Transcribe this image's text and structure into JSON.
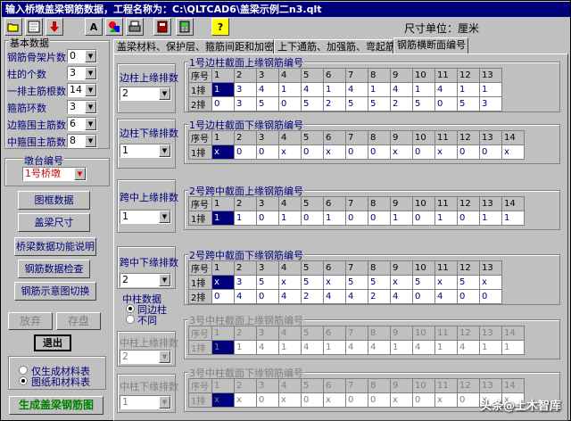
{
  "window": {
    "title": "输入桥墩盖梁钢筋数据，工程名称为：C:\\QLTCAD6\\盖梁示例二n3.qlt"
  },
  "toolbar": {
    "icons": [
      "open-icon",
      "save-icon",
      "down-arrow-icon",
      "font-icon",
      "database-icon",
      "print-icon",
      "exit-icon",
      "calculator-icon",
      "help-icon"
    ],
    "font_label": "A",
    "help_label": "?",
    "unit_label": "尺寸单位：厘米"
  },
  "basic": {
    "title": "基本数据",
    "fields": [
      {
        "label": "钢筋骨架片数",
        "value": "0"
      },
      {
        "label": "柱的个数",
        "value": "3"
      },
      {
        "label": "一排主筋根数",
        "value": "14"
      },
      {
        "label": "箍筋环数",
        "value": "3"
      },
      {
        "label": "边箍围主筋数",
        "value": "6"
      },
      {
        "label": "中箍围主筋数",
        "value": "8"
      }
    ]
  },
  "pier": {
    "title": "墩台编号",
    "value": "1号桥墩"
  },
  "side_buttons": [
    "图框数据",
    "盖梁尺寸",
    "桥梁数据功能说明",
    "钢筋数据检查",
    "钢筋示意图切换"
  ],
  "actions": {
    "abandon": "放弃",
    "save": "存盘",
    "exit": "退出"
  },
  "output_options": {
    "opt1": "仅生成材料表",
    "opt2": "图纸和材料表",
    "selected": 2
  },
  "generate": "生成盖梁钢筋图",
  "tabs": [
    {
      "label": "盖梁材料、保护层、箍筋间距和加密"
    },
    {
      "label": "上下通筋、加强筋、弯起筋"
    },
    {
      "label": "钢筋横断面编号",
      "active": true
    }
  ],
  "row_controls": [
    {
      "label": "边柱上缘排数",
      "value": "2",
      "disabled": false
    },
    {
      "label": "边柱下缘排数",
      "value": "1",
      "disabled": false
    },
    {
      "label": "跨中上缘排数",
      "value": "1",
      "disabled": false
    },
    {
      "label": "跨中下缘排数",
      "value": "2",
      "disabled": false
    },
    {
      "label": "中柱上缘排数",
      "value": "2",
      "disabled": true
    },
    {
      "label": "中柱下缘排数",
      "value": "1",
      "disabled": true
    }
  ],
  "mid_column": {
    "title": "中柱数据",
    "opt1": "同边柱",
    "opt2": "不同",
    "selected": 1
  },
  "sections": [
    {
      "title": "1号边柱截面上缘钢筋编号",
      "disabled": false,
      "header": [
        "序号",
        "1",
        "2",
        "3",
        "4",
        "5",
        "6",
        "7",
        "8",
        "9",
        "10",
        "11",
        "12",
        "13"
      ],
      "rows": [
        [
          "1排",
          "1",
          "3",
          "4",
          "1",
          "4",
          "1",
          "4",
          "1",
          "4",
          "1",
          "4",
          "1",
          "1"
        ],
        [
          "2排",
          "0",
          "3",
          "5",
          "0",
          "5",
          "2",
          "5",
          "5",
          "2",
          "5",
          "0",
          "5",
          "3"
        ]
      ]
    },
    {
      "title": "1号边柱截面下缘钢筋编号",
      "disabled": false,
      "header": [
        "序号",
        "1",
        "2",
        "3",
        "4",
        "5",
        "6",
        "7",
        "8",
        "9",
        "10",
        "11",
        "12",
        "13",
        "14"
      ],
      "rows": [
        [
          "1排",
          "x",
          "0",
          "0",
          "x",
          "0",
          "x",
          "0",
          "0",
          "x",
          "0",
          "x",
          "0",
          "0",
          "x"
        ]
      ]
    },
    {
      "title": "2号跨中截面上缘钢筋编号",
      "disabled": false,
      "header": [
        "序号",
        "1",
        "2",
        "3",
        "4",
        "5",
        "6",
        "7",
        "8",
        "9",
        "10",
        "11",
        "12",
        "13",
        "14"
      ],
      "rows": [
        [
          "1排",
          "1",
          "1",
          "0",
          "1",
          "0",
          "1",
          "0",
          "0",
          "1",
          "0",
          "1",
          "0",
          "1",
          "1"
        ]
      ]
    },
    {
      "title": "2号跨中截面下缘钢筋编号",
      "disabled": false,
      "header": [
        "序号",
        "1",
        "2",
        "3",
        "4",
        "5",
        "6",
        "7",
        "8",
        "9",
        "10",
        "11",
        "12",
        "13"
      ],
      "rows": [
        [
          "1排",
          "x",
          "3",
          "5",
          "x",
          "5",
          "x",
          "5",
          "5",
          "x",
          "5",
          "x",
          "5",
          "x"
        ],
        [
          "2排",
          "0",
          "4",
          "0",
          "4",
          "2",
          "4",
          "4",
          "2",
          "4",
          "0",
          "4",
          "0",
          "0"
        ]
      ]
    },
    {
      "title": "3号中柱截面上缘钢筋编号",
      "disabled": true,
      "header": [
        "序号",
        "1",
        "2",
        "3",
        "4",
        "5",
        "6",
        "7",
        "8",
        "9",
        "10",
        "11",
        "12",
        "13",
        "14"
      ],
      "rows": [
        [
          "1排",
          "1",
          "1",
          "4",
          "1",
          "4",
          "1",
          "4",
          "4",
          "1",
          "4",
          "1",
          "4",
          "1",
          "1"
        ]
      ]
    },
    {
      "title": "3号中柱截面下缘钢筋编号",
      "disabled": true,
      "header": [
        "序号",
        "1",
        "2",
        "3",
        "4",
        "5",
        "6",
        "7",
        "8",
        "9",
        "10",
        "11",
        "12",
        "13",
        "14"
      ],
      "rows": [
        [
          "1排",
          "x",
          "x",
          "0",
          "x",
          "0",
          "x",
          "0",
          "0",
          "x",
          "0",
          "x",
          "0",
          "x",
          "x"
        ]
      ]
    }
  ],
  "watermark": "头条@土木智库"
}
